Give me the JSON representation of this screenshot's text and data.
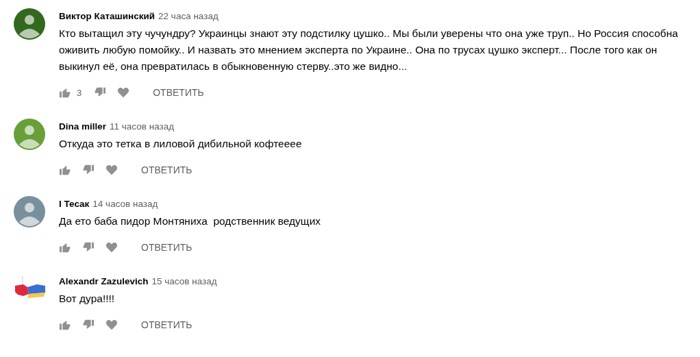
{
  "comments": [
    {
      "author": "Виктор Каташинский",
      "time": "22 часа назад",
      "text": "Кто вытащил эту чучундру? Украинцы знают эту подстилку цушко.. Мы были уверены что она уже труп.. Но Россия способна оживить любую помойку.. И назвать это мнением эксперта по Украине.. Она по трусах цушко эксперт... После того как он выкинул её, она превратилась в обыкновенную стерву..это же видно...",
      "avatar": {
        "kind": "default",
        "color": "#33691e"
      },
      "likes": "3",
      "reply": "ОТВЕТИТЬ"
    },
    {
      "author": "Dina miller",
      "time": "11 часов назад",
      "text": "Откуда это тетка в лиловой дибильной кофтееее",
      "avatar": {
        "kind": "default",
        "color": "#689f38"
      },
      "reply": "ОТВЕТИТЬ"
    },
    {
      "author": "I Тесак",
      "time": "14 часов назад",
      "text": "Да ето баба пидор Монтяниха  родственник ведущих",
      "avatar": {
        "kind": "default",
        "color": "#78909c"
      },
      "reply": "ОТВЕТИТЬ"
    },
    {
      "author": "Alexandr Zazulevich",
      "time": "15 часов назад",
      "text": "Вот дура!!!!",
      "reply": "ОТВЕТИТЬ"
    }
  ]
}
